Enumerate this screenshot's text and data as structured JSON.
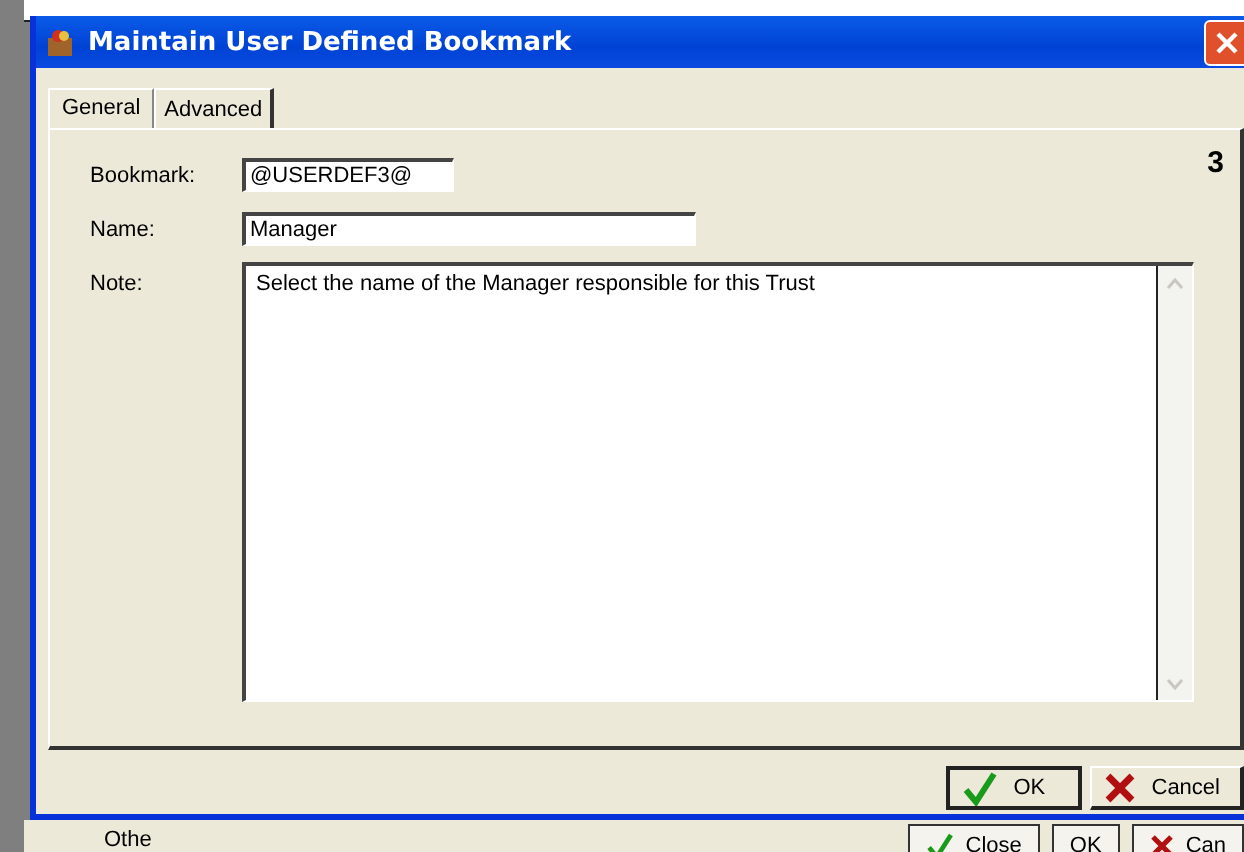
{
  "background_window": {
    "label": "Othe",
    "buttons": [
      {
        "label": "Close",
        "kind": "ok"
      },
      {
        "label": "OK",
        "kind": "plain"
      },
      {
        "label": "Can",
        "kind": "cancel"
      }
    ]
  },
  "window": {
    "title": "Maintain User Defined Bookmark"
  },
  "tabs": [
    {
      "label": "General",
      "selected": true
    },
    {
      "label": "Advanced",
      "selected": false
    }
  ],
  "page_number": "3",
  "fields": [
    {
      "label": "Bookmark:",
      "value": "@USERDEF3@",
      "kind": "short"
    },
    {
      "label": "Name:",
      "value": "Manager",
      "kind": "medium"
    },
    {
      "label": "Note:",
      "value": "Select the name of the Manager responsible for this Trust",
      "kind": "multiline"
    }
  ],
  "buttons": [
    {
      "label": "OK",
      "kind": "ok"
    },
    {
      "label": "Cancel",
      "kind": "cancel"
    }
  ]
}
